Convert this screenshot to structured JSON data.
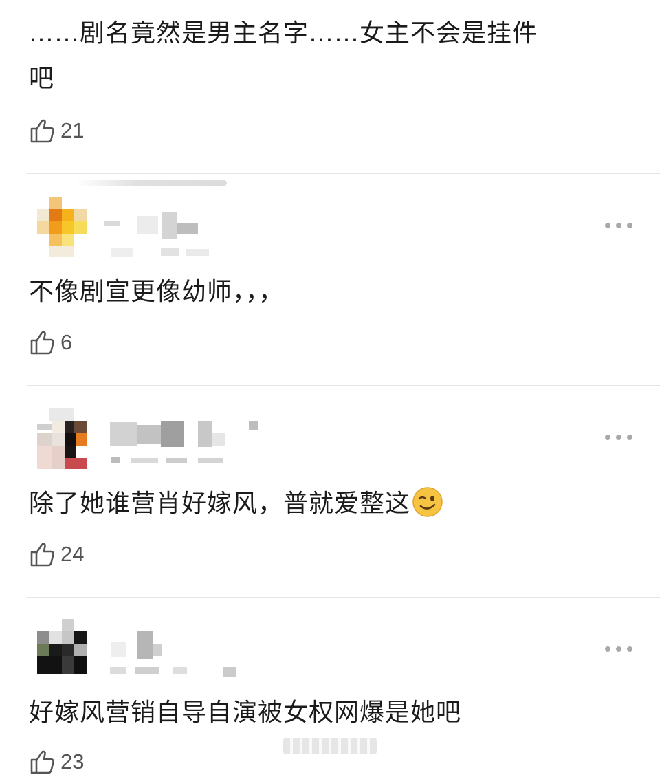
{
  "comments": [
    {
      "text_line1": "……剧名竟然是男主名字……女主不会是挂件",
      "text_line2": "吧",
      "likes": "21"
    },
    {
      "text": "不像剧宣更像幼师，，，",
      "likes": "6"
    },
    {
      "text": "除了她谁营肖好嫁风，普就爱整这",
      "emoji": "wink-emoji",
      "likes": "24"
    },
    {
      "text": "好嫁风营销自导自演被女权网爆是她吧",
      "likes": "23"
    }
  ],
  "icons": {
    "like": "thumbs-up-icon",
    "more": "more-dots-icon"
  },
  "colors": {
    "text": "#1b1b1b",
    "meta": "#555555",
    "divider": "#e4e4e4",
    "dots": "#a9a9a9",
    "emoji": "#f6c342"
  }
}
